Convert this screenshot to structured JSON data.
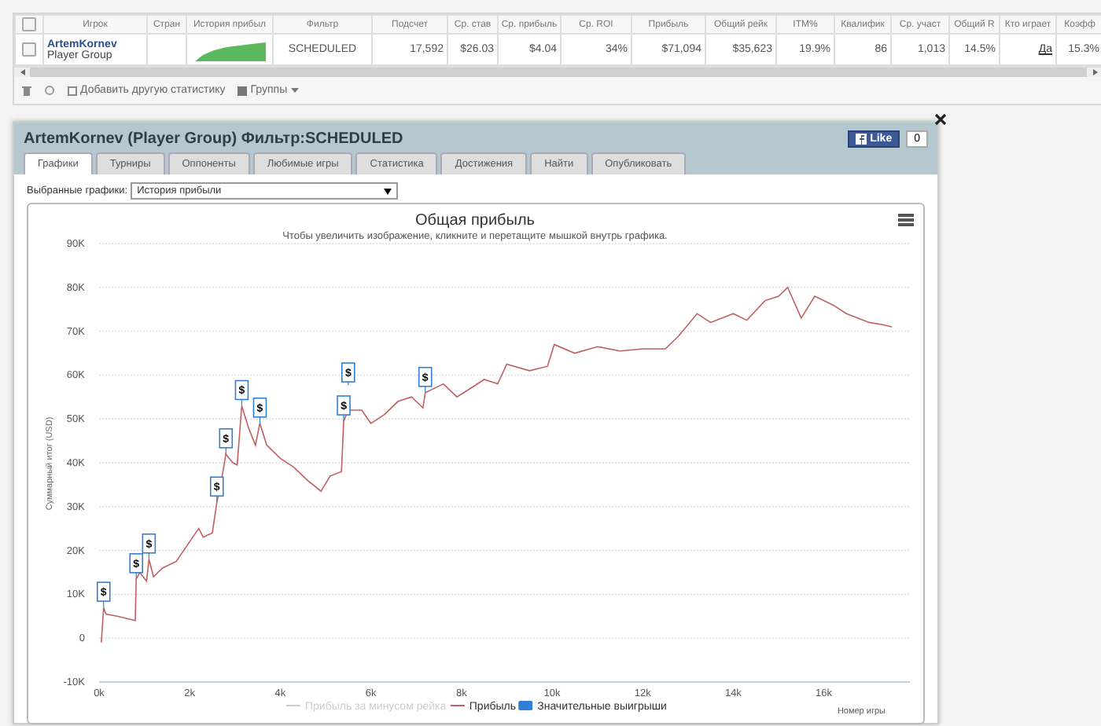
{
  "stats_table": {
    "columns": [
      "Игрок",
      "Стран",
      "История прибыл",
      "Фильтр",
      "Подсчет",
      "Ср. став",
      "Ср. прибыль",
      "Ср. ROI",
      "Прибыль",
      "Общий рейк",
      "ITM%",
      "Квалифик",
      "Ср. участ",
      "Общий R",
      "Кто играет",
      "Коэфф"
    ],
    "rows": [
      {
        "selected": false,
        "player": "ArtemKornev",
        "group": "Player Group",
        "values": [
          {
            "kind": "text",
            "text": "SCHEDULED"
          },
          {
            "kind": "text",
            "text": "17,592"
          },
          {
            "kind": "text",
            "text": "$26.03"
          },
          {
            "kind": "text",
            "text": "$4.04"
          },
          {
            "kind": "text",
            "text": "34%"
          },
          {
            "kind": "text",
            "text": "$71,094"
          },
          {
            "kind": "text",
            "text": "$35,623"
          },
          {
            "kind": "text",
            "text": "19.9%"
          },
          {
            "kind": "text",
            "text": "86"
          },
          {
            "kind": "text",
            "text": "1,013"
          },
          {
            "kind": "text",
            "text": "14.5%"
          },
          {
            "kind": "link",
            "text": "Да"
          },
          {
            "kind": "text",
            "text": "15.3%"
          }
        ]
      }
    ],
    "all_selected": false,
    "add_stat": "Добавить другую статистику",
    "groups": "Группы"
  },
  "panel": {
    "title": "ArtemKornev (Player Group) Фильтр:SCHEDULED",
    "like": {
      "label": "Like",
      "count": "0"
    },
    "tabs": [
      {
        "label": "Графики",
        "selected": true
      },
      {
        "label": "Турниры",
        "selected": false
      },
      {
        "label": "Оппоненты",
        "selected": false
      },
      {
        "label": "Любимые игры",
        "selected": false
      },
      {
        "label": "Статистика",
        "selected": false
      },
      {
        "label": "Достижения",
        "selected": false
      },
      {
        "label": "Найти",
        "selected": false
      },
      {
        "label": "Опубликовать",
        "selected": false
      }
    ],
    "chart_selector": {
      "label": "Выбранные графики:",
      "value": "История прибыли"
    },
    "chart": {
      "subtitle": "Чтобы увеличить изображение, кликните и перетащите мышкой внутрь графика.",
      "legend": [
        {
          "label": "Прибыль за минусом рейка",
          "kind": "line",
          "visible": false
        },
        {
          "kind": "series",
          "visible": true
        },
        {
          "label": "Значительные выигрыши",
          "kind": "flag",
          "visible": true,
          "color": "#2f7ed8"
        }
      ],
      "chart_data": {
        "type": "line",
        "title": "Общая прибыль",
        "xlabel": "Номер игры",
        "ylabel": "Суммарный итог (USD)",
        "grid": true,
        "xlim": [
          0,
          17900
        ],
        "ylim": [
          -10000,
          90000
        ],
        "xticks": [
          {
            "value": 0,
            "label": "0k"
          },
          {
            "value": 2000,
            "label": "2k"
          },
          {
            "value": 4000,
            "label": "4k"
          },
          {
            "value": 6000,
            "label": "6k"
          },
          {
            "value": 8000,
            "label": "8k"
          },
          {
            "value": 10000,
            "label": "10k"
          },
          {
            "value": 12000,
            "label": "12k"
          },
          {
            "value": 14000,
            "label": "14k"
          },
          {
            "value": 16000,
            "label": "16k"
          }
        ],
        "yticks": [
          {
            "value": -10000,
            "label": "-10K"
          },
          {
            "value": 0,
            "label": "0"
          },
          {
            "value": 10000,
            "label": "10K"
          },
          {
            "value": 20000,
            "label": "20K"
          },
          {
            "value": 30000,
            "label": "30K"
          },
          {
            "value": 40000,
            "label": "40K"
          },
          {
            "value": 50000,
            "label": "50K"
          },
          {
            "value": 60000,
            "label": "60K"
          },
          {
            "value": 70000,
            "label": "70K"
          },
          {
            "value": 80000,
            "label": "80K"
          },
          {
            "value": 90000,
            "label": "90K"
          }
        ],
        "x": [
          50,
          100,
          150,
          400,
          800,
          820,
          900,
          1050,
          1100,
          1200,
          1400,
          1700,
          2000,
          2200,
          2300,
          2500,
          2600,
          2700,
          2800,
          2950,
          3050,
          3150,
          3300,
          3450,
          3550,
          3700,
          4000,
          4300,
          4600,
          4900,
          5100,
          5350,
          5400,
          5500,
          5800,
          6000,
          6300,
          6600,
          6900,
          7150,
          7200,
          7600,
          7900,
          8200,
          8500,
          8800,
          9000,
          9500,
          9900,
          10050,
          10500,
          11000,
          11500,
          12000,
          12500,
          12800,
          13200,
          13500,
          14000,
          14300,
          14700,
          15000,
          15200,
          15500,
          15800,
          16200,
          16500,
          17000,
          17300,
          17500
        ],
        "series": [
          {
            "name": "Прибыль",
            "color": "#c06060",
            "values": [
              -1000,
              7000,
              5500,
              5000,
              4000,
              13500,
              15000,
              13000,
              18000,
              14000,
              16000,
              17500,
              22000,
              25000,
              23000,
              24000,
              31000,
              36000,
              42000,
              40000,
              39500,
              53000,
              48000,
              44000,
              49000,
              44000,
              41000,
              39000,
              36000,
              33500,
              37000,
              38000,
              49500,
              52000,
              52000,
              49000,
              51000,
              54000,
              55000,
              52500,
              56000,
              58000,
              55000,
              57000,
              59000,
              58000,
              62500,
              61000,
              62000,
              67000,
              65000,
              66500,
              65500,
              66000,
              66000,
              69000,
              74000,
              72000,
              74000,
              72500,
              77000,
              78000,
              80000,
              73000,
              78000,
              76000,
              74000,
              72000,
              71500,
              71000
            ]
          }
        ],
        "annotations": [
          {
            "x": 100,
            "y": 7000,
            "text": "$"
          },
          {
            "x": 820,
            "y": 13500,
            "text": "$"
          },
          {
            "x": 1100,
            "y": 18000,
            "text": "$"
          },
          {
            "x": 2600,
            "y": 31000,
            "text": "$"
          },
          {
            "x": 2800,
            "y": 42000,
            "text": "$"
          },
          {
            "x": 3150,
            "y": 53000,
            "text": "$"
          },
          {
            "x": 3550,
            "y": 49000,
            "text": "$"
          },
          {
            "x": 5400,
            "y": 49500,
            "text": "$"
          },
          {
            "x": 5500,
            "y": 52000,
            "text": "$"
          },
          {
            "x": 7200,
            "y": 56000,
            "text": "$"
          }
        ]
      }
    }
  }
}
